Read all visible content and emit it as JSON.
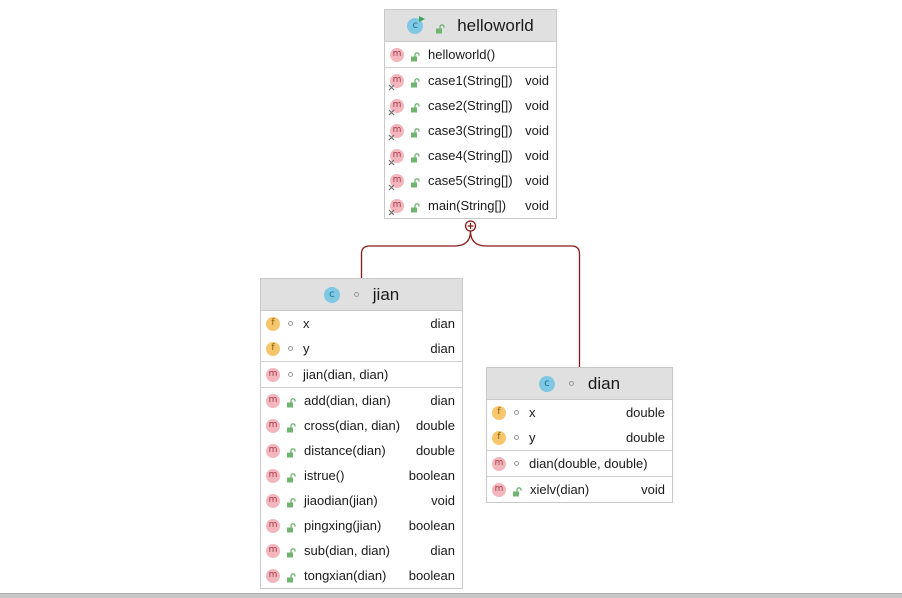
{
  "colors": {
    "connector": "#8b1a1a",
    "header_bg": "#e0e0e0",
    "method_icon": "#f4b6bd",
    "field_icon": "#f6c66d",
    "class_icon": "#7ec8e3",
    "public_lock": "#6fb56f"
  },
  "icons": {
    "class": "class-icon",
    "method": "method-icon",
    "field": "field-icon",
    "public": "public-lock-icon",
    "package": "package-private-icon",
    "inner_class_anchor": "circle-plus-icon"
  },
  "classes": [
    {
      "id": "helloworld",
      "name": "helloworld",
      "visibility": "public",
      "runnable": true,
      "sections": [
        {
          "members": [
            {
              "kind": "m",
              "visibility": "public",
              "name": "helloworld()",
              "type": ""
            }
          ]
        },
        {
          "members": [
            {
              "kind": "m",
              "visibility": "public",
              "static": true,
              "name": "case1(String[])",
              "type": "void"
            },
            {
              "kind": "m",
              "visibility": "public",
              "static": true,
              "name": "case2(String[])",
              "type": "void"
            },
            {
              "kind": "m",
              "visibility": "public",
              "static": true,
              "name": "case3(String[])",
              "type": "void"
            },
            {
              "kind": "m",
              "visibility": "public",
              "static": true,
              "name": "case4(String[])",
              "type": "void"
            },
            {
              "kind": "m",
              "visibility": "public",
              "static": true,
              "name": "case5(String[])",
              "type": "void"
            },
            {
              "kind": "m",
              "visibility": "public",
              "static": true,
              "name": "main(String[])",
              "type": "void"
            }
          ]
        }
      ]
    },
    {
      "id": "jian",
      "name": "jian",
      "visibility": "package",
      "runnable": false,
      "sections": [
        {
          "members": [
            {
              "kind": "f",
              "visibility": "package",
              "name": "x",
              "type": "dian"
            },
            {
              "kind": "f",
              "visibility": "package",
              "name": "y",
              "type": "dian"
            }
          ]
        },
        {
          "members": [
            {
              "kind": "m",
              "visibility": "package",
              "name": "jian(dian, dian)",
              "type": ""
            }
          ]
        },
        {
          "members": [
            {
              "kind": "m",
              "visibility": "public",
              "name": "add(dian, dian)",
              "type": "dian"
            },
            {
              "kind": "m",
              "visibility": "public",
              "name": "cross(dian, dian)",
              "type": "double"
            },
            {
              "kind": "m",
              "visibility": "public",
              "name": "distance(dian)",
              "type": "double"
            },
            {
              "kind": "m",
              "visibility": "public",
              "name": "istrue()",
              "type": "boolean"
            },
            {
              "kind": "m",
              "visibility": "public",
              "name": "jiaodian(jian)",
              "type": "void"
            },
            {
              "kind": "m",
              "visibility": "public",
              "name": "pingxing(jian)",
              "type": "boolean"
            },
            {
              "kind": "m",
              "visibility": "public",
              "name": "sub(dian, dian)",
              "type": "dian"
            },
            {
              "kind": "m",
              "visibility": "public",
              "name": "tongxian(dian)",
              "type": "boolean"
            }
          ]
        }
      ]
    },
    {
      "id": "dian",
      "name": "dian",
      "visibility": "package",
      "runnable": false,
      "sections": [
        {
          "members": [
            {
              "kind": "f",
              "visibility": "package",
              "name": "x",
              "type": "double"
            },
            {
              "kind": "f",
              "visibility": "package",
              "name": "y",
              "type": "double"
            }
          ]
        },
        {
          "members": [
            {
              "kind": "m",
              "visibility": "package",
              "name": "dian(double, double)",
              "type": ""
            }
          ]
        },
        {
          "members": [
            {
              "kind": "m",
              "visibility": "public",
              "name": "xielv(dian)",
              "type": "void"
            }
          ]
        }
      ]
    }
  ]
}
